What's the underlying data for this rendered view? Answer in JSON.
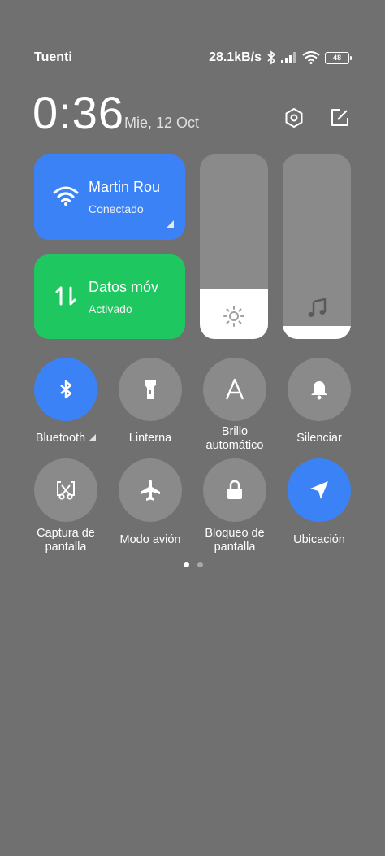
{
  "status": {
    "carrier": "Tuenti",
    "speed": "28.1kB/s",
    "battery": "48"
  },
  "header": {
    "time": "0:36",
    "date": "Mie, 12 Oct"
  },
  "tiles": {
    "wifi": {
      "title": "Martin Rou",
      "subtitle": "Conectado",
      "color": "#3b82f7"
    },
    "data": {
      "title": "Datos móv",
      "subtitle": "Activado",
      "color": "#1ec760"
    }
  },
  "sliders": {
    "brightness": {
      "level": 0.27
    },
    "volume": {
      "level": 0.07
    }
  },
  "toggles": [
    {
      "label": "Bluetooth",
      "icon": "bluetooth-icon",
      "on": true
    },
    {
      "label": "Linterna",
      "icon": "flashlight-icon",
      "on": false
    },
    {
      "label": "Brillo automático",
      "icon": "auto-brightness-icon",
      "on": false
    },
    {
      "label": "Silenciar",
      "icon": "bell-icon",
      "on": false
    },
    {
      "label": "Captura de pantalla",
      "icon": "screenshot-icon",
      "on": false
    },
    {
      "label": "Modo avión",
      "icon": "airplane-icon",
      "on": false
    },
    {
      "label": "Bloqueo de pantalla",
      "icon": "lock-icon",
      "on": false
    },
    {
      "label": "Ubicación",
      "icon": "location-icon",
      "on": true
    }
  ],
  "pager": {
    "pages": 2,
    "current": 1
  }
}
